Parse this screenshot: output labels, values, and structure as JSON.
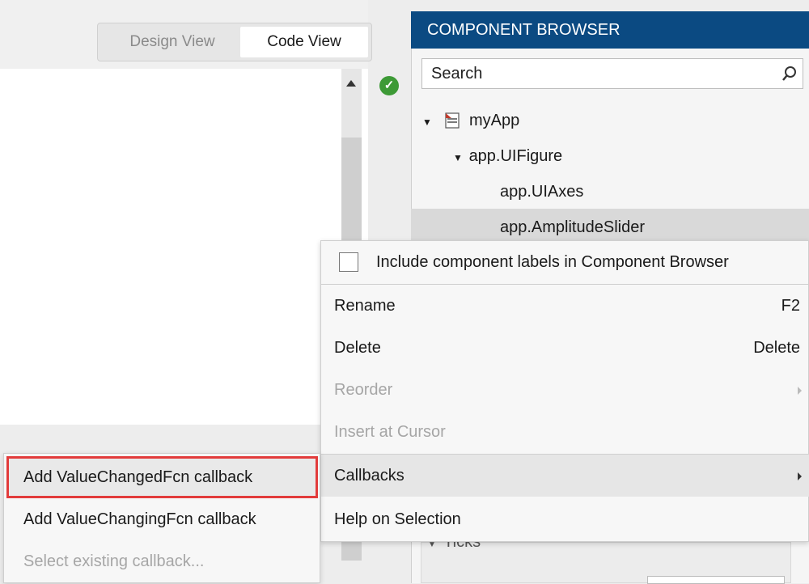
{
  "view_toggle": {
    "design": "Design View",
    "code": "Code View"
  },
  "component_browser": {
    "title": "COMPONENT BROWSER",
    "search_placeholder": "Search",
    "tree": [
      {
        "label": "myApp",
        "icon": "app-file-icon"
      },
      {
        "label": "app.UIFigure"
      },
      {
        "label": "app.UIAxes"
      },
      {
        "label": "app.AmplitudeSlider"
      }
    ],
    "partial_row": "Ticks"
  },
  "context_menu": {
    "checkbox_label": "Include component labels in Component Browser",
    "checkbox_checked": false,
    "items": [
      {
        "label": "Rename",
        "shortcut": "F2",
        "enabled": true
      },
      {
        "label": "Delete",
        "shortcut": "Delete",
        "enabled": true
      },
      {
        "label": "Reorder",
        "enabled": false
      },
      {
        "label": "Insert at Cursor",
        "enabled": false
      },
      {
        "label": "Callbacks",
        "enabled": true
      },
      {
        "label": "Help on Selection",
        "enabled": true
      }
    ]
  },
  "callbacks_submenu": [
    {
      "label": "Add ValueChangedFcn callback",
      "enabled": true,
      "highlighted": true
    },
    {
      "label": "Add ValueChangingFcn callback",
      "enabled": true
    },
    {
      "label": "Select existing callback...",
      "enabled": false
    }
  ],
  "colors": {
    "header": "#0b4a82",
    "highlight_border": "#e23b3b",
    "status_ok": "#3d9a36"
  }
}
